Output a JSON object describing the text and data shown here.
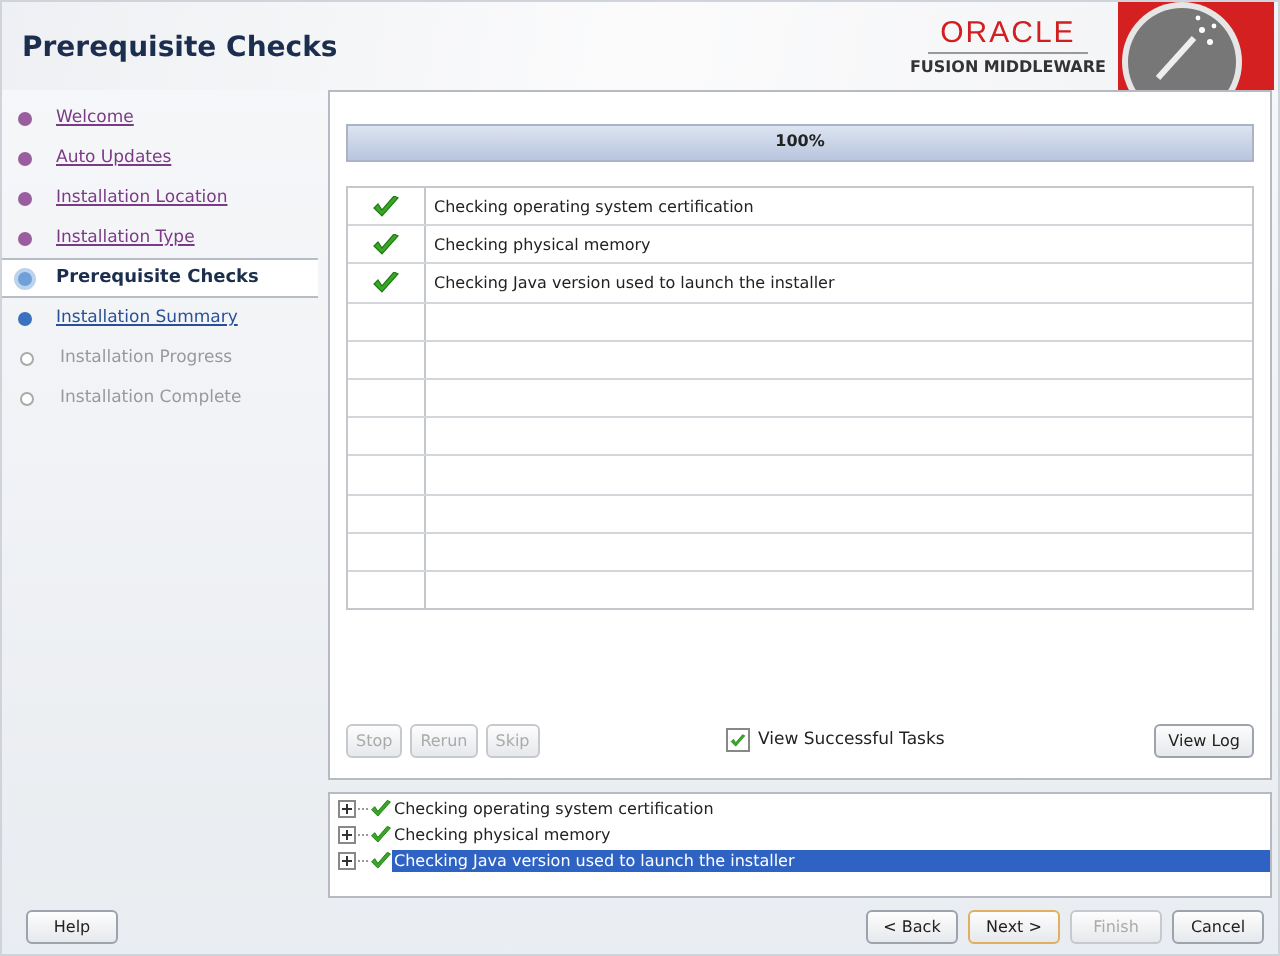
{
  "window": {
    "title": "Prerequisite Checks"
  },
  "logo": {
    "brand": "ORACLE",
    "product": "FUSION MIDDLEWARE"
  },
  "steps": [
    {
      "label": "Welcome",
      "visited": true,
      "disabled": false,
      "selected": false
    },
    {
      "label": "Auto Updates",
      "visited": true,
      "disabled": false,
      "selected": false
    },
    {
      "label": "Installation Location",
      "visited": true,
      "disabled": false,
      "selected": false
    },
    {
      "label": "Installation Type",
      "visited": true,
      "disabled": false,
      "selected": false
    },
    {
      "label": "Prerequisite Checks",
      "visited": false,
      "disabled": false,
      "selected": true
    },
    {
      "label": "Installation Summary",
      "visited": false,
      "disabled": false,
      "selected": false
    },
    {
      "label": "Installation Progress",
      "visited": false,
      "disabled": true,
      "selected": false
    },
    {
      "label": "Installation Complete",
      "visited": false,
      "disabled": true,
      "selected": false
    }
  ],
  "progress": {
    "level": 1,
    "reading": "100%"
  },
  "checks": [
    {
      "passed": true,
      "text": "Checking operating system certification"
    },
    {
      "passed": true,
      "text": "Checking physical memory"
    },
    {
      "passed": true,
      "text": "Checking Java version used to launch the installer"
    }
  ],
  "actions": [
    {
      "label": "Stop",
      "disabled": true
    },
    {
      "label": "Rerun",
      "disabled": true
    },
    {
      "label": "Skip",
      "disabled": true
    }
  ],
  "view_successful": {
    "label": "View Successful Tasks",
    "checked": true
  },
  "view_log": {
    "label": "View Log",
    "disabled": false
  },
  "details": [
    {
      "text": "Checking operating system certification",
      "passed": true,
      "expanded": false,
      "selected": false
    },
    {
      "text": "Checking physical memory",
      "passed": true,
      "expanded": false,
      "selected": false
    },
    {
      "text": "Checking Java version used to launch the installer",
      "passed": true,
      "expanded": false,
      "selected": true
    }
  ],
  "footer": {
    "help": {
      "label": "Help",
      "disabled": false
    },
    "buttons": [
      {
        "label": "< Back",
        "disabled": false,
        "default": false
      },
      {
        "label": "Next >",
        "disabled": false,
        "default": true
      },
      {
        "label": "Finish",
        "disabled": true,
        "default": false
      },
      {
        "label": "Cancel",
        "disabled": false,
        "default": false
      }
    ]
  }
}
